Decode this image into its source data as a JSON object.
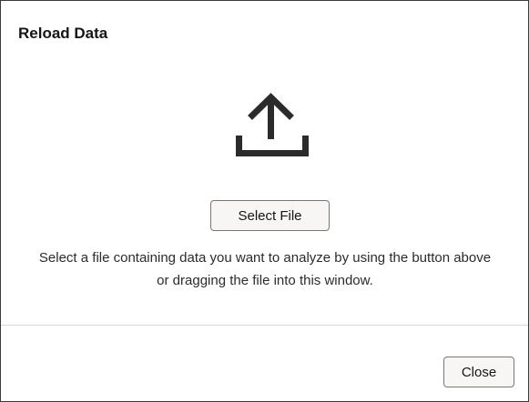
{
  "dialog": {
    "title": "Reload Data",
    "icon": "upload-icon",
    "select_file_label": "Select File",
    "description": "Select a file containing data you want to analyze by using the button above or dragging the file into this window.",
    "close_label": "Close"
  }
}
